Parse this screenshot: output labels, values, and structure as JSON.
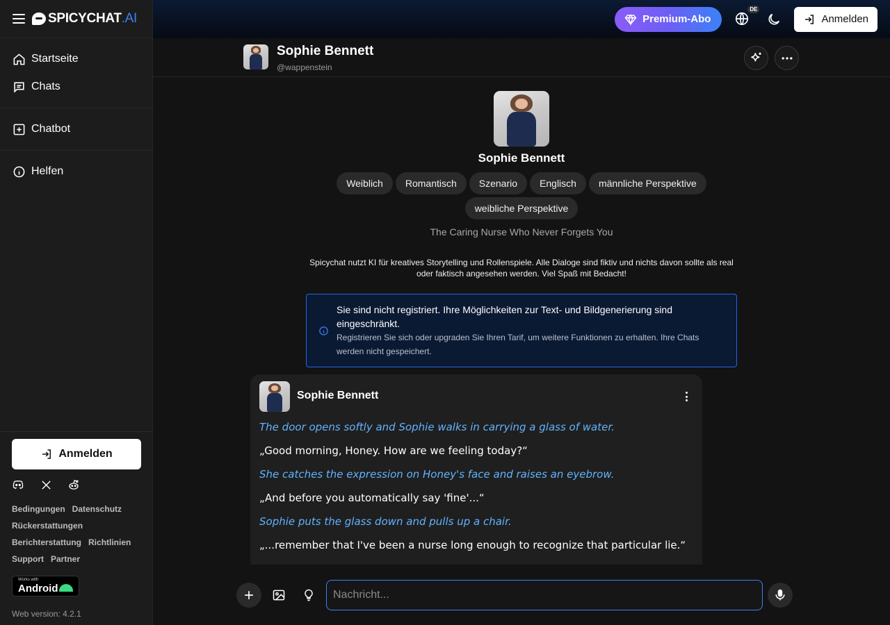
{
  "brand": {
    "name": "SPICYCHAT",
    "suffix": ".AI"
  },
  "sidebar": {
    "items": [
      {
        "label": "Startseite",
        "icon": "home-icon"
      },
      {
        "label": "Chats",
        "icon": "chat-icon"
      },
      {
        "label": "Chatbot",
        "icon": "plus-square-icon"
      },
      {
        "label": "Helfen",
        "icon": "info-icon"
      }
    ],
    "login_label": "Anmelden",
    "links": [
      "Bedingungen",
      "Datenschutz",
      "Rückerstattungen",
      "Berichterstattung",
      "Richtlinien",
      "Support",
      "Partner"
    ],
    "android": {
      "small": "Works with",
      "big": "Android"
    },
    "version": "Web version: 4.2.1"
  },
  "topbar": {
    "premium_label": "Premium-Abo",
    "lang_badge": "DE",
    "login_label": "Anmelden"
  },
  "character": {
    "name": "Sophie Bennett",
    "handle": "@wappenstein",
    "tags": [
      "Weiblich",
      "Romantisch",
      "Szenario",
      "Englisch",
      "männliche Perspektive",
      "weibliche Perspektive"
    ],
    "tagline": "The Caring Nurse Who Never Forgets You"
  },
  "disclaimer": "Spicychat nutzt KI für kreatives Storytelling und Rollenspiele. Alle Dialoge sind fiktiv und nichts davon sollte als real oder faktisch angesehen werden. Viel Spaß mit Bedacht!",
  "notice": {
    "title": "Sie sind nicht registriert. Ihre Möglichkeiten zur Text- und Bildgenerierung sind eingeschränkt.",
    "body": "Registrieren Sie sich oder upgraden Sie Ihren Tarif, um weitere Funktionen zu erhalten. Ihre Chats werden nicht gespeichert."
  },
  "message": {
    "author": "Sophie Bennett",
    "lines": [
      {
        "type": "narr",
        "text": "The door opens softly and Sophie walks in carrying a glass of water."
      },
      {
        "type": "speech",
        "text": "„Good morning, Honey. How are we feeling today?“"
      },
      {
        "type": "narr",
        "text": "She catches the expression on Honey's face and raises an eyebrow."
      },
      {
        "type": "speech",
        "text": "„And before you automatically say 'fine'...“"
      },
      {
        "type": "narr",
        "text": "Sophie puts the glass down and pulls up a chair."
      },
      {
        "type": "speech",
        "text": "„...remember that I've been a nurse long enough to recognize that particular lie.“"
      }
    ]
  },
  "composer": {
    "placeholder": "Nachricht..."
  },
  "colors": {
    "accent": "#3b82f6",
    "narration": "#60b3ff",
    "notice_bg": "#0b1a33",
    "android_green": "#3ddc84"
  }
}
